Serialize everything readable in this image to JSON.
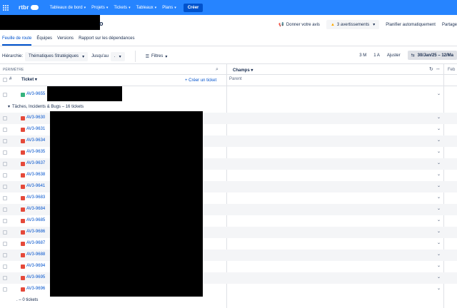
{
  "topnav": {
    "logo_text": "rtbr",
    "items": [
      {
        "label": "Tableaux de bord"
      },
      {
        "label": "Projets"
      },
      {
        "label": "Tickets"
      },
      {
        "label": "Tableaux"
      },
      {
        "label": "Plans"
      }
    ],
    "create_label": "Créer"
  },
  "header": {
    "title_tail": "o",
    "feedback_label": "Donner votre avis",
    "warnings_label": "3 avertissements",
    "auto_plan_label": "Planifier automatiquement",
    "share_label": "Partage"
  },
  "tabs": [
    {
      "label": "Feuille de route"
    },
    {
      "label": "Équipes"
    },
    {
      "label": "Versions"
    },
    {
      "label": "Rapport sur les dépendances"
    }
  ],
  "filters": {
    "hierarchy_label": "Hiérarchie:",
    "hierarchy_value": "Thématiques Stratégiques",
    "until_label": "Jusqu'au",
    "until_value": ".",
    "filters_label": "Filtres",
    "range_3m": "3 M",
    "range_1a": "1 A",
    "adjust_label": "Ajuster",
    "date_range": "30/Jan/25 – 12/Ma"
  },
  "table": {
    "scope_label": "PÉRIMÈTRE",
    "hash_label": "#",
    "ticket_label": "Ticket",
    "create_ticket_label": "+ Créer un ticket",
    "fields_label": "Champs",
    "parent_label": "Parent",
    "month_label": "Feb",
    "top_row_id": "AV3-9655",
    "group_label": "Tâches, Incidents & Bugs – 16 tickets",
    "rows": [
      "AV3-9630",
      "AV3-9631",
      "AV3-9634",
      "AV3-9635",
      "AV3-9637",
      "AV3-9638",
      "AV3-9641",
      "AV3-9683",
      "AV3-9684",
      "AV3-9685",
      "AV3-9686",
      "AV3-9687",
      "AV3-9688",
      "AV3-9694",
      "AV3-9695",
      "AV3-9696"
    ],
    "footer_label": ". – 0 tickets"
  },
  "colors": {
    "nav": "#2684ff",
    "accent": "#0052cc",
    "bug": "#e5493a",
    "story": "#36b37e"
  }
}
